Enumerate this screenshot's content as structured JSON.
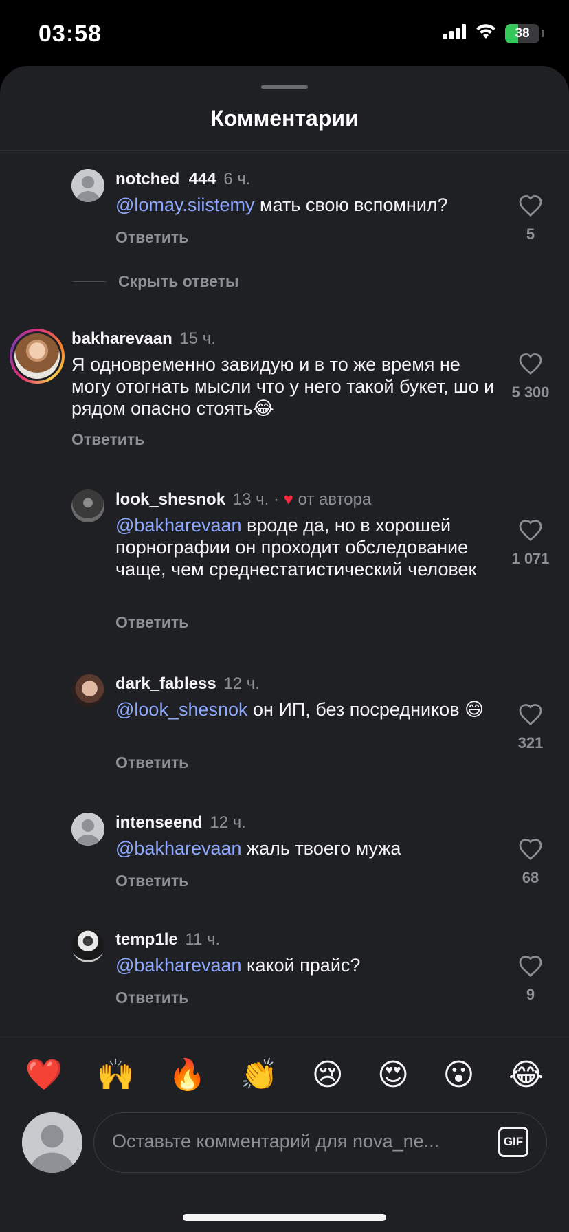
{
  "status_bar": {
    "time": "03:58",
    "battery": "38",
    "battery_level_pct": 38
  },
  "sheet": {
    "title": "Комментарии"
  },
  "comments": [
    {
      "username": "notched_444",
      "time": "6 ч.",
      "mention": "@lomay.siistemy",
      "text": " мать свою вспомнил?",
      "reply": "Ответить",
      "likes": "5"
    },
    {
      "hide_replies": "Скрыть ответы"
    },
    {
      "username": "bakharevaan",
      "time": "15 ч.",
      "mention": "",
      "text": "Я одновременно завидую и в то же время не могу отогнать мысли что у него такой букет, шо и рядом опасно стоять😂",
      "reply": "Ответить",
      "likes": "5 300"
    },
    {
      "username": "look_shesnok",
      "time": "13 ч. ·",
      "author_like": "от автора",
      "mention": "@bakharevaan",
      "text": " вроде да, но в хорошей порнографии он проходит обследование чаще, чем среднестатистический человек",
      "reply": "Ответить",
      "likes": "1 071"
    },
    {
      "username": "dark_fabless",
      "time": "12 ч.",
      "mention": "@look_shesnok",
      "text": " он ИП, без посредников 😄",
      "reply": "Ответить",
      "likes": "321"
    },
    {
      "username": "intenseend",
      "time": "12 ч.",
      "mention": "@bakharevaan",
      "text": " жаль твоего мужа",
      "reply": "Ответить",
      "likes": "68"
    },
    {
      "username": "temp1le",
      "time": "11 ч.",
      "mention": "@bakharevaan",
      "text": " какой прайс?",
      "reply": "Ответить",
      "likes": "9"
    }
  ],
  "emoji_bar": [
    "❤️",
    "🙌",
    "🔥",
    "👏",
    "😢",
    "😍",
    "😮",
    "😂"
  ],
  "composer": {
    "placeholder": "Оставьте комментарий для nova_ne...",
    "gif_label": "GIF"
  },
  "colors": {
    "background": "#1f2024",
    "mention": "#8ea8ff",
    "muted": "#8e8f94",
    "heart_red": "#ed2d3c",
    "battery_green": "#34c759"
  }
}
